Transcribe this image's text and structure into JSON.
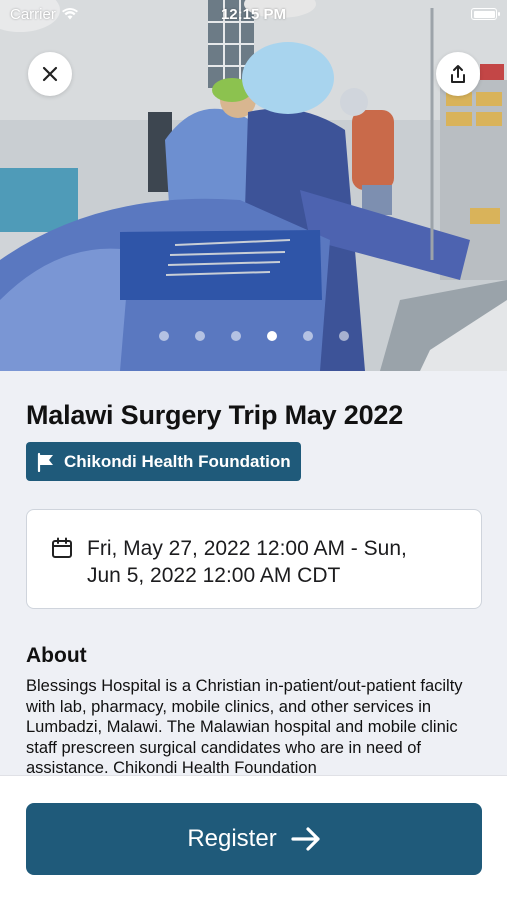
{
  "status_bar": {
    "carrier": "Carrier",
    "time": "12:15 PM"
  },
  "hero": {
    "image_description_icon": "photo",
    "carousel": {
      "count": 6,
      "active_index": 3
    }
  },
  "actions": {
    "close_icon": "close-icon",
    "share_icon": "share-icon"
  },
  "event": {
    "title": "Malawi Surgery Trip May 2022",
    "organization": "Chikondi Health Foundation",
    "date_line1": "Fri, May 27, 2022 12:00 AM - Sun,",
    "date_line2": "Jun 5, 2022 12:00 AM CDT"
  },
  "about": {
    "heading": "About",
    "body": "Blessings Hospital is a Christian in-patient/out-patient facilty with lab, pharmacy, mobile clinics, and other services in Lumbadzi, Malawi.  The Malawian hospital and mobile clinic staff prescreen surgical candidates who are in need of assistance.  Chikondi Health Foundation"
  },
  "register": {
    "label": "Register"
  },
  "colors": {
    "accent": "#1f5a7a",
    "background": "#eef0f5"
  }
}
